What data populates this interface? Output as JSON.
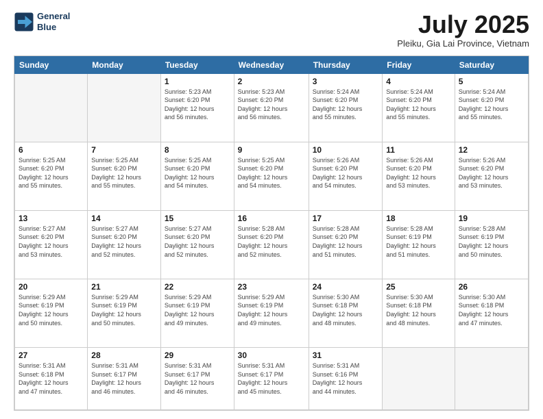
{
  "logo": {
    "line1": "General",
    "line2": "Blue"
  },
  "title": "July 2025",
  "subtitle": "Pleiku, Gia Lai Province, Vietnam",
  "headers": [
    "Sunday",
    "Monday",
    "Tuesday",
    "Wednesday",
    "Thursday",
    "Friday",
    "Saturday"
  ],
  "weeks": [
    [
      {
        "day": "",
        "info": ""
      },
      {
        "day": "",
        "info": ""
      },
      {
        "day": "1",
        "info": "Sunrise: 5:23 AM\nSunset: 6:20 PM\nDaylight: 12 hours\nand 56 minutes."
      },
      {
        "day": "2",
        "info": "Sunrise: 5:23 AM\nSunset: 6:20 PM\nDaylight: 12 hours\nand 56 minutes."
      },
      {
        "day": "3",
        "info": "Sunrise: 5:24 AM\nSunset: 6:20 PM\nDaylight: 12 hours\nand 55 minutes."
      },
      {
        "day": "4",
        "info": "Sunrise: 5:24 AM\nSunset: 6:20 PM\nDaylight: 12 hours\nand 55 minutes."
      },
      {
        "day": "5",
        "info": "Sunrise: 5:24 AM\nSunset: 6:20 PM\nDaylight: 12 hours\nand 55 minutes."
      }
    ],
    [
      {
        "day": "6",
        "info": "Sunrise: 5:25 AM\nSunset: 6:20 PM\nDaylight: 12 hours\nand 55 minutes."
      },
      {
        "day": "7",
        "info": "Sunrise: 5:25 AM\nSunset: 6:20 PM\nDaylight: 12 hours\nand 55 minutes."
      },
      {
        "day": "8",
        "info": "Sunrise: 5:25 AM\nSunset: 6:20 PM\nDaylight: 12 hours\nand 54 minutes."
      },
      {
        "day": "9",
        "info": "Sunrise: 5:25 AM\nSunset: 6:20 PM\nDaylight: 12 hours\nand 54 minutes."
      },
      {
        "day": "10",
        "info": "Sunrise: 5:26 AM\nSunset: 6:20 PM\nDaylight: 12 hours\nand 54 minutes."
      },
      {
        "day": "11",
        "info": "Sunrise: 5:26 AM\nSunset: 6:20 PM\nDaylight: 12 hours\nand 53 minutes."
      },
      {
        "day": "12",
        "info": "Sunrise: 5:26 AM\nSunset: 6:20 PM\nDaylight: 12 hours\nand 53 minutes."
      }
    ],
    [
      {
        "day": "13",
        "info": "Sunrise: 5:27 AM\nSunset: 6:20 PM\nDaylight: 12 hours\nand 53 minutes."
      },
      {
        "day": "14",
        "info": "Sunrise: 5:27 AM\nSunset: 6:20 PM\nDaylight: 12 hours\nand 52 minutes."
      },
      {
        "day": "15",
        "info": "Sunrise: 5:27 AM\nSunset: 6:20 PM\nDaylight: 12 hours\nand 52 minutes."
      },
      {
        "day": "16",
        "info": "Sunrise: 5:28 AM\nSunset: 6:20 PM\nDaylight: 12 hours\nand 52 minutes."
      },
      {
        "day": "17",
        "info": "Sunrise: 5:28 AM\nSunset: 6:20 PM\nDaylight: 12 hours\nand 51 minutes."
      },
      {
        "day": "18",
        "info": "Sunrise: 5:28 AM\nSunset: 6:19 PM\nDaylight: 12 hours\nand 51 minutes."
      },
      {
        "day": "19",
        "info": "Sunrise: 5:28 AM\nSunset: 6:19 PM\nDaylight: 12 hours\nand 50 minutes."
      }
    ],
    [
      {
        "day": "20",
        "info": "Sunrise: 5:29 AM\nSunset: 6:19 PM\nDaylight: 12 hours\nand 50 minutes."
      },
      {
        "day": "21",
        "info": "Sunrise: 5:29 AM\nSunset: 6:19 PM\nDaylight: 12 hours\nand 50 minutes."
      },
      {
        "day": "22",
        "info": "Sunrise: 5:29 AM\nSunset: 6:19 PM\nDaylight: 12 hours\nand 49 minutes."
      },
      {
        "day": "23",
        "info": "Sunrise: 5:29 AM\nSunset: 6:19 PM\nDaylight: 12 hours\nand 49 minutes."
      },
      {
        "day": "24",
        "info": "Sunrise: 5:30 AM\nSunset: 6:18 PM\nDaylight: 12 hours\nand 48 minutes."
      },
      {
        "day": "25",
        "info": "Sunrise: 5:30 AM\nSunset: 6:18 PM\nDaylight: 12 hours\nand 48 minutes."
      },
      {
        "day": "26",
        "info": "Sunrise: 5:30 AM\nSunset: 6:18 PM\nDaylight: 12 hours\nand 47 minutes."
      }
    ],
    [
      {
        "day": "27",
        "info": "Sunrise: 5:31 AM\nSunset: 6:18 PM\nDaylight: 12 hours\nand 47 minutes."
      },
      {
        "day": "28",
        "info": "Sunrise: 5:31 AM\nSunset: 6:17 PM\nDaylight: 12 hours\nand 46 minutes."
      },
      {
        "day": "29",
        "info": "Sunrise: 5:31 AM\nSunset: 6:17 PM\nDaylight: 12 hours\nand 46 minutes."
      },
      {
        "day": "30",
        "info": "Sunrise: 5:31 AM\nSunset: 6:17 PM\nDaylight: 12 hours\nand 45 minutes."
      },
      {
        "day": "31",
        "info": "Sunrise: 5:31 AM\nSunset: 6:16 PM\nDaylight: 12 hours\nand 44 minutes."
      },
      {
        "day": "",
        "info": ""
      },
      {
        "day": "",
        "info": ""
      }
    ]
  ]
}
